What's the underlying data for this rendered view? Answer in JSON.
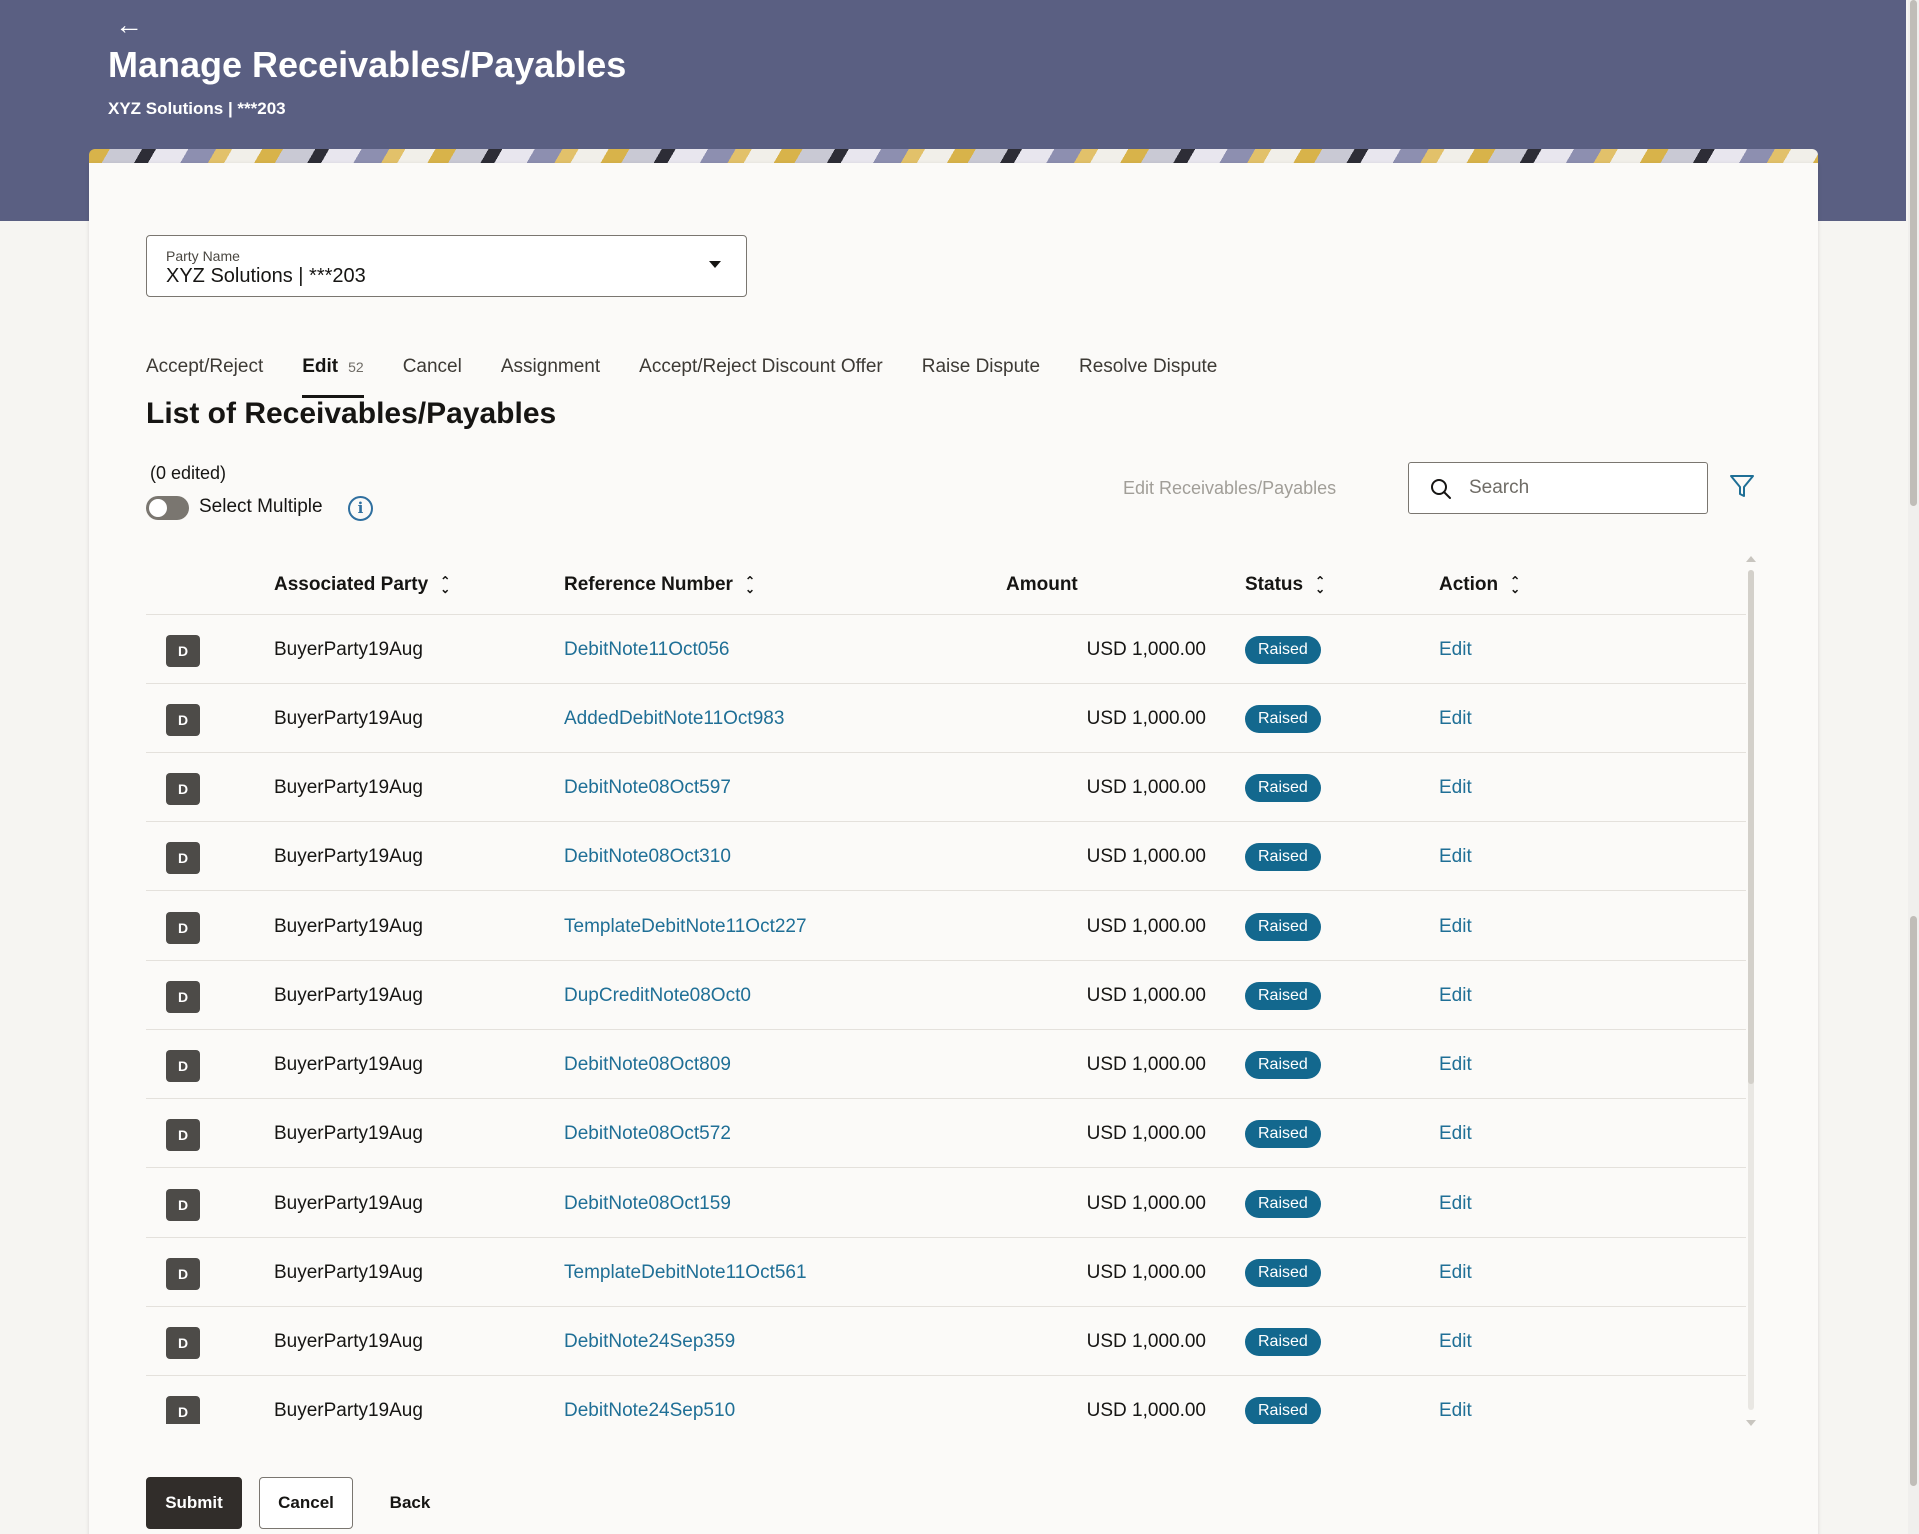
{
  "header": {
    "title": "Manage Receivables/Payables",
    "subtitle": "XYZ Solutions | ***203",
    "back_icon": "arrow-left-icon",
    "colors": {
      "banner": "#5a5f82"
    }
  },
  "party_select": {
    "label": "Party Name",
    "value": "XYZ Solutions | ***203"
  },
  "tabs": [
    {
      "label": "Accept/Reject"
    },
    {
      "label": "Edit",
      "count": "52",
      "active": true
    },
    {
      "label": "Cancel"
    },
    {
      "label": "Assignment"
    },
    {
      "label": "Accept/Reject Discount Offer"
    },
    {
      "label": "Raise Dispute"
    },
    {
      "label": "Resolve Dispute"
    }
  ],
  "list": {
    "title": "List of Receivables/Payables",
    "edited_count": "(0 edited)",
    "select_multiple_label": "Select Multiple",
    "select_multiple_on": false,
    "edit_button_label": "Edit Receivables/Payables",
    "search_placeholder": "Search"
  },
  "table": {
    "columns": {
      "party": "Associated Party",
      "reference": "Reference Number",
      "amount": "Amount",
      "status": "Status",
      "action": "Action"
    },
    "rows": [
      {
        "avatar": "D",
        "party": "BuyerParty19Aug",
        "reference": "DebitNote11Oct056",
        "amount": "USD 1,000.00",
        "status": "Raised",
        "action": "Edit"
      },
      {
        "avatar": "D",
        "party": "BuyerParty19Aug",
        "reference": "AddedDebitNote11Oct983",
        "amount": "USD 1,000.00",
        "status": "Raised",
        "action": "Edit"
      },
      {
        "avatar": "D",
        "party": "BuyerParty19Aug",
        "reference": "DebitNote08Oct597",
        "amount": "USD 1,000.00",
        "status": "Raised",
        "action": "Edit"
      },
      {
        "avatar": "D",
        "party": "BuyerParty19Aug",
        "reference": "DebitNote08Oct310",
        "amount": "USD 1,000.00",
        "status": "Raised",
        "action": "Edit"
      },
      {
        "avatar": "D",
        "party": "BuyerParty19Aug",
        "reference": "TemplateDebitNote11Oct227",
        "amount": "USD 1,000.00",
        "status": "Raised",
        "action": "Edit"
      },
      {
        "avatar": "D",
        "party": "BuyerParty19Aug",
        "reference": "DupCreditNote08Oct0",
        "amount": "USD 1,000.00",
        "status": "Raised",
        "action": "Edit"
      },
      {
        "avatar": "D",
        "party": "BuyerParty19Aug",
        "reference": "DebitNote08Oct809",
        "amount": "USD 1,000.00",
        "status": "Raised",
        "action": "Edit"
      },
      {
        "avatar": "D",
        "party": "BuyerParty19Aug",
        "reference": "DebitNote08Oct572",
        "amount": "USD 1,000.00",
        "status": "Raised",
        "action": "Edit"
      },
      {
        "avatar": "D",
        "party": "BuyerParty19Aug",
        "reference": "DebitNote08Oct159",
        "amount": "USD 1,000.00",
        "status": "Raised",
        "action": "Edit"
      },
      {
        "avatar": "D",
        "party": "BuyerParty19Aug",
        "reference": "TemplateDebitNote11Oct561",
        "amount": "USD 1,000.00",
        "status": "Raised",
        "action": "Edit"
      },
      {
        "avatar": "D",
        "party": "BuyerParty19Aug",
        "reference": "DebitNote24Sep359",
        "amount": "USD 1,000.00",
        "status": "Raised",
        "action": "Edit"
      },
      {
        "avatar": "D",
        "party": "BuyerParty19Aug",
        "reference": "DebitNote24Sep510",
        "amount": "USD 1,000.00",
        "status": "Raised",
        "action": "Edit"
      }
    ],
    "colors": {
      "link": "#1f6f96",
      "status_badge": "#13688e"
    }
  },
  "footer": {
    "submit_label": "Submit",
    "cancel_label": "Cancel",
    "back_label": "Back"
  }
}
